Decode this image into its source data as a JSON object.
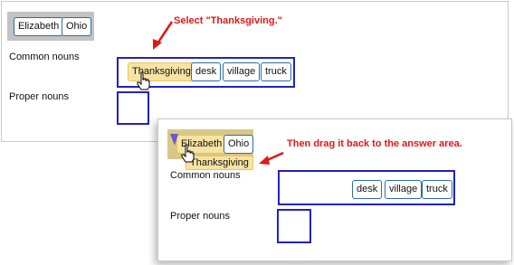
{
  "bank_words": [
    "Elizabeth",
    "Ohio"
  ],
  "rows": {
    "common_label": "Common nouns",
    "proper_label": "Proper nouns"
  },
  "step1": {
    "instruction": "Select \"Thanksgiving.\"",
    "common_answers": [
      "Thanksgiving",
      "desk",
      "village",
      "truck"
    ]
  },
  "step2": {
    "instruction": "Then drag it back to the answer area.",
    "common_answers": [
      "desk",
      "village",
      "truck"
    ],
    "dragged_word": "Thanksgiving"
  },
  "colors": {
    "annotation": "#e31616",
    "drop_zone_border": "#2121c7",
    "chip_border": "#2a6ea7",
    "selected_chip": "#f7e3a2",
    "word_bank": "#c3c3c3"
  },
  "icons": [
    "hand-cursor-icon",
    "insertion-marker-icon",
    "annotation-arrow-icon"
  ]
}
